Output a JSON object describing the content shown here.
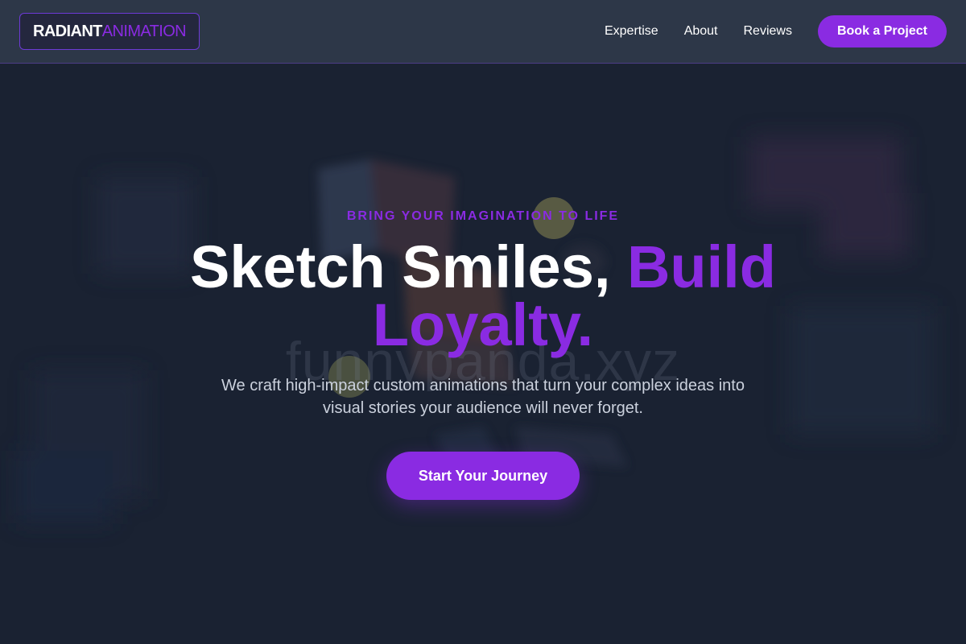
{
  "header": {
    "logo": {
      "part_a": "RADIANT",
      "part_b": "ANIMATION"
    },
    "nav": [
      {
        "label": "Expertise"
      },
      {
        "label": "About"
      },
      {
        "label": "Reviews"
      }
    ],
    "cta_label": "Book a Project"
  },
  "hero": {
    "eyebrow": "BRING YOUR IMAGINATION TO LIFE",
    "headline": {
      "white": "Sketch Smiles, ",
      "accent": "Build Loyalty."
    },
    "subtext": "We craft high-impact custom animations that turn your complex ideas into visual stories your audience will never forget.",
    "cta_label": "Start Your Journey",
    "watermark": "funnypanda.xyz"
  },
  "colors": {
    "accent": "#8a2be2",
    "header_bg": "#2d3748",
    "hero_bg": "#1a2232"
  }
}
